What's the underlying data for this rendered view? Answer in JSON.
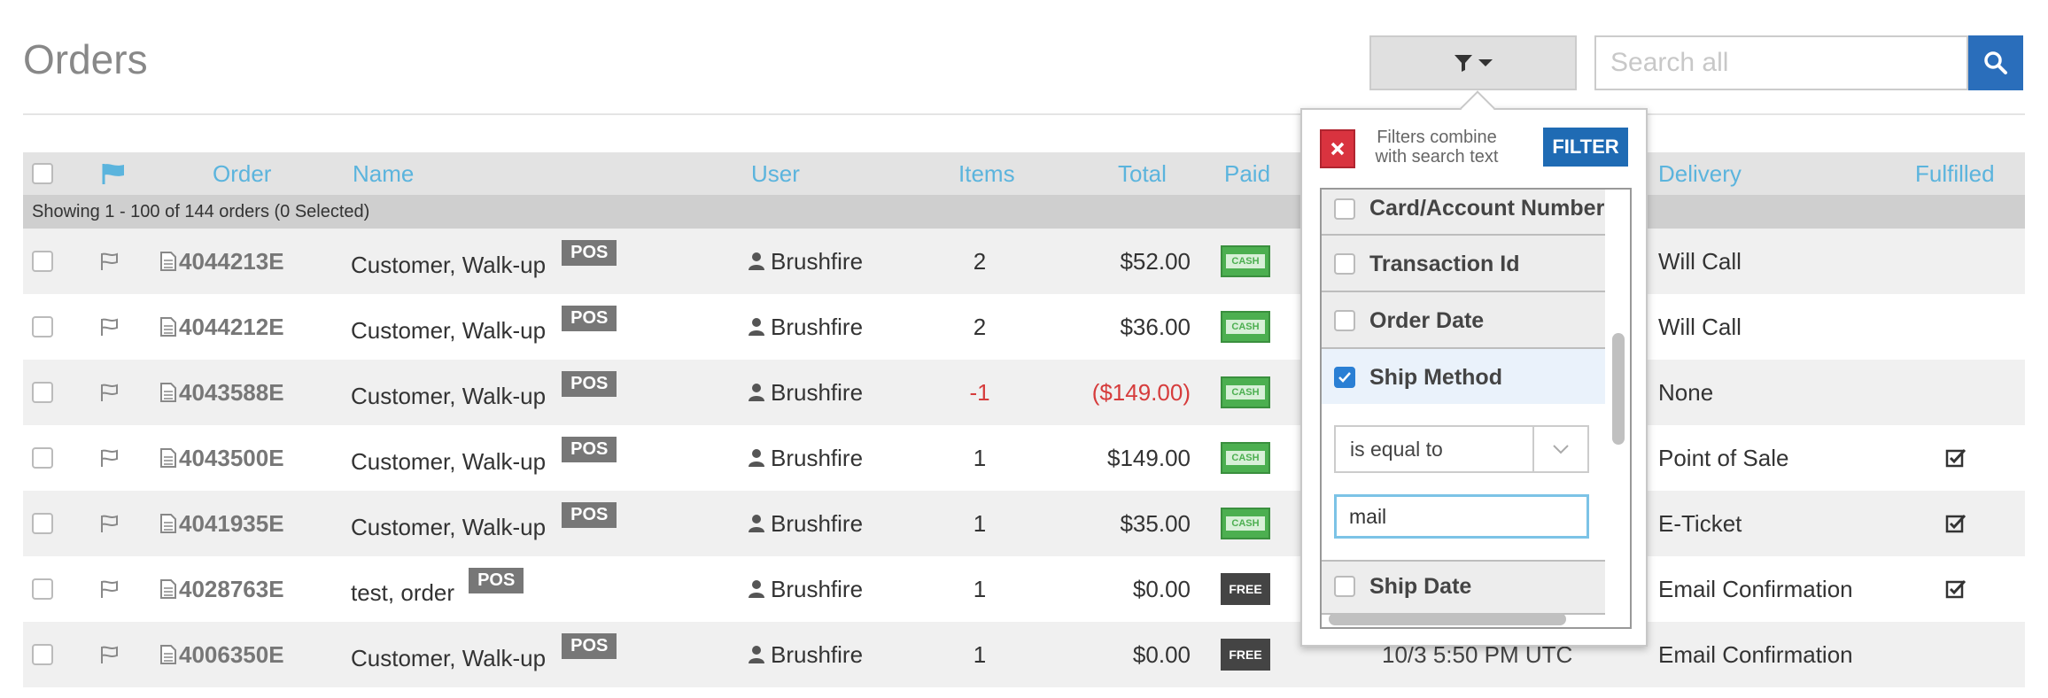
{
  "page": {
    "title": "Orders"
  },
  "toolbar": {
    "search_placeholder": "Search all",
    "search_value": ""
  },
  "table": {
    "headers": {
      "order": "Order",
      "name": "Name",
      "user": "User",
      "items": "Items",
      "total": "Total",
      "paid": "Paid",
      "delivery": "Delivery",
      "fulfilled": "Fulfilled"
    },
    "status": "Showing 1 - 100 of 144 orders (0 Selected)",
    "rows": [
      {
        "order": "4044213E",
        "name": "Customer, Walk-up",
        "badge": "POS",
        "user": "Brushfire",
        "items": "2",
        "total": "$52.00",
        "paid": "CASH",
        "date": "",
        "delivery": "Will Call",
        "fulfilled": false,
        "negative": false
      },
      {
        "order": "4044212E",
        "name": "Customer, Walk-up",
        "badge": "POS",
        "user": "Brushfire",
        "items": "2",
        "total": "$36.00",
        "paid": "CASH",
        "date": "",
        "delivery": "Will Call",
        "fulfilled": false,
        "negative": false
      },
      {
        "order": "4043588E",
        "name": "Customer, Walk-up",
        "badge": "POS",
        "user": "Brushfire",
        "items": "-1",
        "total": "($149.00)",
        "paid": "CASH",
        "date": "",
        "delivery": "None",
        "fulfilled": false,
        "negative": true
      },
      {
        "order": "4043500E",
        "name": "Customer, Walk-up",
        "badge": "POS",
        "user": "Brushfire",
        "items": "1",
        "total": "$149.00",
        "paid": "CASH",
        "date": "",
        "delivery": "Point of Sale",
        "fulfilled": true,
        "negative": false
      },
      {
        "order": "4041935E",
        "name": "Customer, Walk-up",
        "badge": "POS",
        "user": "Brushfire",
        "items": "1",
        "total": "$35.00",
        "paid": "CASH",
        "date": "",
        "delivery": "E-Ticket",
        "fulfilled": true,
        "negative": false
      },
      {
        "order": "4028763E",
        "name": "test, order",
        "badge": "POS",
        "user": "Brushfire",
        "items": "1",
        "total": "$0.00",
        "paid": "FREE",
        "date": "",
        "delivery": "Email Confirmation",
        "fulfilled": true,
        "negative": false
      },
      {
        "order": "4006350E",
        "name": "Customer, Walk-up",
        "badge": "POS",
        "user": "Brushfire",
        "items": "1",
        "total": "$0.00",
        "paid": "FREE",
        "date": "10/3 5:50 PM UTC",
        "delivery": "Email Confirmation",
        "fulfilled": false,
        "negative": false
      }
    ]
  },
  "filter_popover": {
    "note": "Filters combine with search text",
    "filter_label": "FILTER",
    "options": [
      {
        "label": "Card/Account Number",
        "checked": false
      },
      {
        "label": "Transaction Id",
        "checked": false
      },
      {
        "label": "Order Date",
        "checked": false
      },
      {
        "label": "Ship Method",
        "checked": true
      },
      {
        "label": "Ship Date",
        "checked": false
      }
    ],
    "operator": "is equal to",
    "value": "mail"
  },
  "icons": {
    "filter_btn": "filter-icon",
    "search_btn": "search-icon",
    "flag_header": "flag-icon",
    "row_flag": "flag-outline-icon",
    "row_doc": "document-icon",
    "user": "user-icon",
    "fulfilled": "checked-box-icon",
    "close": "close-icon"
  },
  "colors": {
    "accent": "#5bb4dd",
    "primary_button": "#1f6bb4",
    "danger": "#d9333f",
    "negative_value": "#d63c3c",
    "cash_badge": "#4caf50"
  }
}
